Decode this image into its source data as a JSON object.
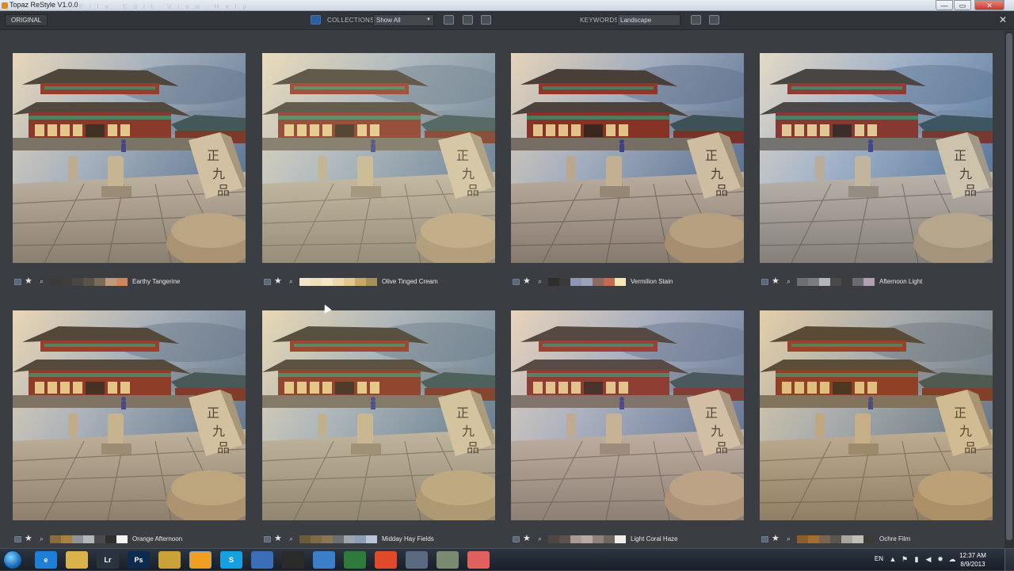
{
  "window": {
    "title": "Topaz ReStyle V1.0.0",
    "menu_ghost": "File  Edit  View  Help"
  },
  "toolbar": {
    "original_label": "ORIGINAL",
    "collections_label": "COLLECTIONS:",
    "collections_value": "Show All",
    "keywords_label": "KEYWORDS:",
    "keywords_value": "Landscape",
    "close_label": "✕"
  },
  "presets": [
    {
      "name": "Earthy Tangerine",
      "swatches": [
        "#3b3a39",
        "#3f3d3b",
        "#4a4743",
        "#5b5348",
        "#7a6a58",
        "#c19a7c",
        "#d0855a"
      ],
      "tint": "#e9b27a",
      "tint_opacity": 0.12
    },
    {
      "name": "Olive Tinged Cream",
      "swatches": [
        "#f1e6c8",
        "#efdfba",
        "#f3e7c4",
        "#ecd9ad",
        "#e3c98d",
        "#c9a96a",
        "#a88f58"
      ],
      "tint": "#f0d9a0",
      "tint_opacity": 0.22
    },
    {
      "name": "Vermilion Stain",
      "swatches": [
        "#2f2e2d",
        "#3a3937",
        "#8a96b4",
        "#9aa3b9",
        "#8a6a62",
        "#c66b4f",
        "#f5e8b6"
      ],
      "tint": "#d08a6a",
      "tint_opacity": 0.1
    },
    {
      "name": "Afternoon Light",
      "swatches": [
        "#6d6f73",
        "#7a7c80",
        "#b5b6b9",
        "#4b4a49",
        "#3e3d3c",
        "#6a6a70",
        "#b39fb2"
      ],
      "tint": "#c8c0d8",
      "tint_opacity": 0.1
    },
    {
      "name": "Orange Afternoon",
      "swatches": [
        "#8a6a3e",
        "#a97f45",
        "#8f9296",
        "#b4b7ba",
        "#4a4a4a",
        "#2f2f2f",
        "#f4f4f4"
      ],
      "tint": "#f0b060",
      "tint_opacity": 0.14
    },
    {
      "name": "Midday Hay Fields",
      "swatches": [
        "#6b5a3c",
        "#7d6a46",
        "#8a7652",
        "#6c6e72",
        "#9ca6b0",
        "#8d9fb5",
        "#b7c5d6"
      ],
      "tint": "#e8c878",
      "tint_opacity": 0.18
    },
    {
      "name": "Light Coral Haze",
      "swatches": [
        "#4f4642",
        "#5c514b",
        "#a89a94",
        "#b9a9a2",
        "#8f817b",
        "#6f6560",
        "#f2ede8"
      ],
      "tint": "#e6a898",
      "tint_opacity": 0.16
    },
    {
      "name": "Ochre Film",
      "swatches": [
        "#8a5f2a",
        "#a06e30",
        "#7a6650",
        "#5a5550",
        "#a8a4a0",
        "#c1bdb8",
        "#3d3b3a"
      ],
      "tint": "#d99a40",
      "tint_opacity": 0.2
    }
  ],
  "taskbar": {
    "apps": [
      {
        "label": "e",
        "color": "#1f7fd6"
      },
      {
        "label": "",
        "color": "#d8b24a"
      },
      {
        "label": "Lr",
        "color": "#2a3440"
      },
      {
        "label": "Ps",
        "color": "#0d2b4f"
      },
      {
        "label": "",
        "color": "#caa23a"
      },
      {
        "label": "",
        "color": "#f0a020"
      },
      {
        "label": "S",
        "color": "#16a0e0"
      },
      {
        "label": "",
        "color": "#3c6db8"
      },
      {
        "label": "",
        "color": "#2a2a2a"
      },
      {
        "label": "",
        "color": "#3b7ec9"
      },
      {
        "label": "",
        "color": "#2d7a3a"
      },
      {
        "label": "",
        "color": "#e04a2a"
      },
      {
        "label": "",
        "color": "#5a6a80"
      },
      {
        "label": "",
        "color": "#7a8a70"
      },
      {
        "label": "",
        "color": "#e06060"
      }
    ],
    "lang": "EN",
    "time": "12:37 AM",
    "date": "8/9/2013"
  }
}
